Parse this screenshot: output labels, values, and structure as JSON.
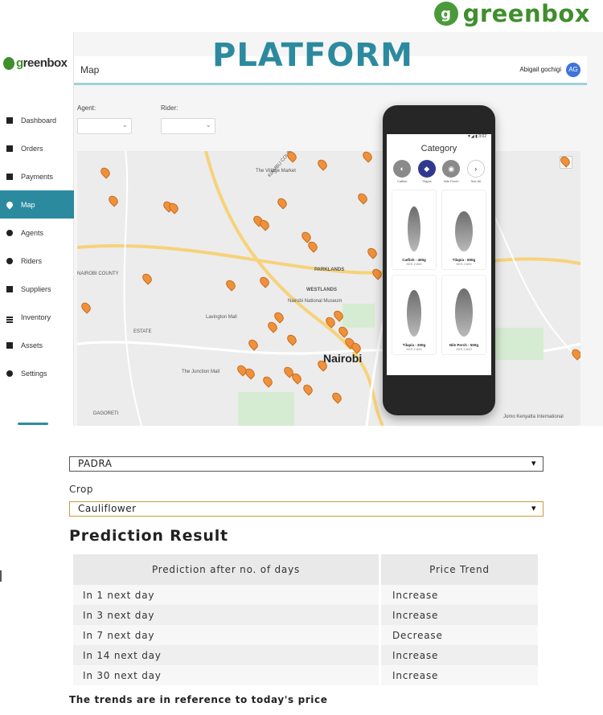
{
  "brand": {
    "name": "greenbox",
    "mark": "g"
  },
  "dashboard": {
    "logo_text_prefix": "g",
    "logo_text_rest": "reenbox",
    "platform_title": "PLATFORM",
    "page_title": "Map",
    "user": {
      "name": "Abigail gochigi",
      "initials": "AG"
    },
    "nav": [
      {
        "label": "Dashboard",
        "icon": "dashboard-icon"
      },
      {
        "label": "Orders",
        "icon": "cart-icon"
      },
      {
        "label": "Payments",
        "icon": "payment-icon"
      },
      {
        "label": "Map",
        "icon": "map-pin-icon",
        "active": true
      },
      {
        "label": "Agents",
        "icon": "agent-icon"
      },
      {
        "label": "Riders",
        "icon": "rider-icon"
      },
      {
        "label": "Suppliers",
        "icon": "truck-icon"
      },
      {
        "label": "Inventory",
        "icon": "list-icon"
      },
      {
        "label": "Assets",
        "icon": "assets-icon"
      },
      {
        "label": "Settings",
        "icon": "gear-icon"
      }
    ],
    "filters": {
      "agent_label": "Agent:",
      "rider_label": "Rider:"
    },
    "map_labels": {
      "nairobi": "Nairobi",
      "parklands": "PARKLANDS",
      "westlands": "WESTLANDS",
      "kiambu_county": "KIAMBU COUNTY",
      "nairobi_county": "NAIROBI COUNTY",
      "dagoreti": "DAGORETI",
      "estate": "ESTATE",
      "village_market": "The Village Market",
      "junction_mall": "The Junction Mall",
      "lavington_mall": "Lavington Mall",
      "nairobi_national_museum": "Nairobi National Museum",
      "kenyatta_intl": "Jomo Kenyatta International"
    },
    "phone": {
      "status": "▼◢ ▮ 3:02",
      "title": "Category",
      "categories": [
        {
          "label": "Catfish",
          "symbol": "◐"
        },
        {
          "label": "Tilapia",
          "symbol": "◆"
        },
        {
          "label": "Nile Perch",
          "symbol": "◉"
        },
        {
          "label": "See All",
          "symbol": "›"
        }
      ],
      "products": [
        {
          "name": "Catfish - 400g",
          "price": "KES 2,600"
        },
        {
          "name": "Tilapia - 500g",
          "price": "KES 2,600"
        },
        {
          "name": "Tilapia - 200g",
          "price": "KES 2,600"
        },
        {
          "name": "Nile Perch - 500g",
          "price": "KES 2,600"
        }
      ]
    }
  },
  "prediction": {
    "market_value": "PADRA",
    "crop_label": "Crop",
    "crop_value": "Cauliflower",
    "title": "Prediction Result",
    "columns": [
      "Prediction after no. of days",
      "Price Trend"
    ],
    "rows": [
      {
        "days": "In 1 next day",
        "trend": "Increase"
      },
      {
        "days": "In 3 next day",
        "trend": "Increase"
      },
      {
        "days": "In 7 next day",
        "trend": "Decrease"
      },
      {
        "days": "In 14 next day",
        "trend": "Increase"
      },
      {
        "days": "In 30 next day",
        "trend": "Increase"
      }
    ],
    "note": "The trends are in reference to today's price"
  },
  "colors": {
    "brand_green": "#3f8f2d",
    "teal": "#2c8a9f",
    "pin_orange": "#f0913a",
    "avatar_blue": "#3d74d9"
  }
}
